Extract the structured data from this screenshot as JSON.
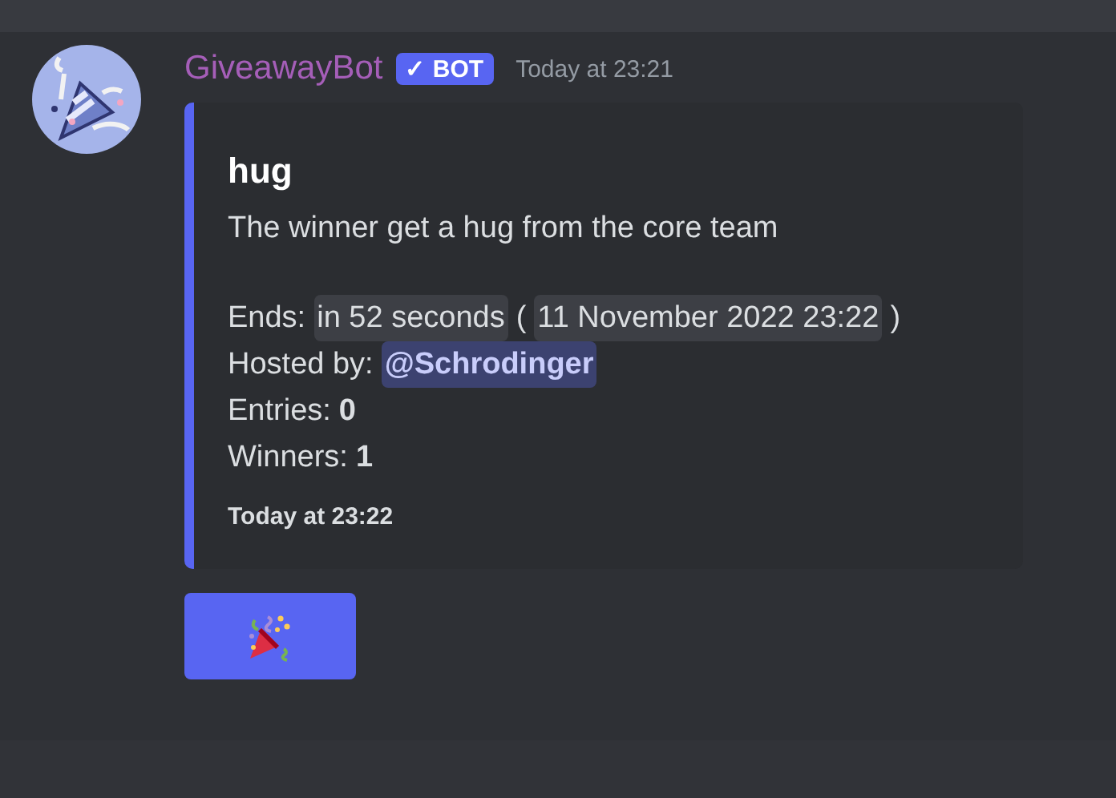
{
  "message": {
    "author": "GiveawayBot",
    "badge": {
      "check": "✓",
      "label": "BOT"
    },
    "time": "Today at 23:21"
  },
  "embed": {
    "title": "hug",
    "description": "The winner get a hug from the core team",
    "fields": [
      {
        "kind": "timestamp",
        "label": "Ends:",
        "relative": "in 52 seconds",
        "open": "(",
        "absolute": "11 November 2022 23:22",
        "close": ")"
      },
      {
        "kind": "mention",
        "label": "Hosted by:",
        "value": "@Schrodinger"
      },
      {
        "kind": "bold",
        "label": "Entries:",
        "value": "0"
      },
      {
        "kind": "bold",
        "label": "Winners:",
        "value": "1"
      }
    ],
    "footer": "Today at 23:22"
  },
  "buttons": [
    {
      "kind": "emoji"
    }
  ]
}
